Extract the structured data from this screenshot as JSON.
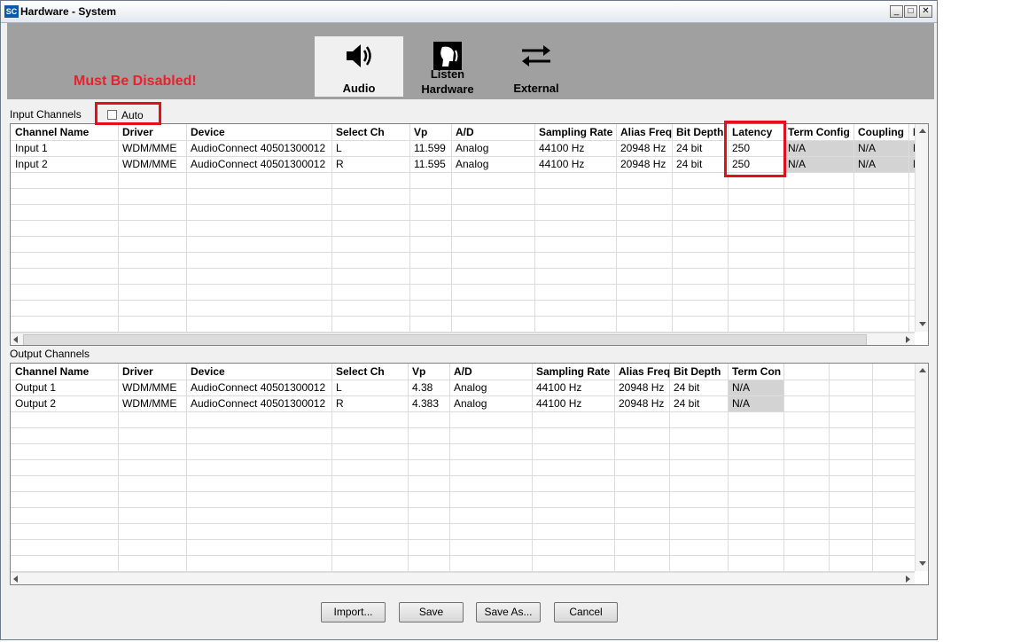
{
  "window": {
    "title": "Hardware - System",
    "icon_text": "SC",
    "controls": [
      "minimize-icon",
      "maximize-icon",
      "close-icon"
    ]
  },
  "toolbar": {
    "audio_label": "Audio",
    "listen_line1": "Listen",
    "listen_line2": "Hardware",
    "external_label": "External"
  },
  "annotation": {
    "warning": "Must Be Disabled!",
    "highlight_color": "#e3101c"
  },
  "input": {
    "section_label": "Input Channels",
    "auto_label": "Auto",
    "auto_checked": false,
    "columns": [
      "Channel Name",
      "Driver",
      "Device",
      "Select Ch",
      "Vp",
      "A/D",
      "Sampling Rate",
      "Alias Freq",
      "Bit Depth",
      "Latency",
      "Term Config",
      "Coupling",
      "I"
    ],
    "rows": [
      [
        "Input 1",
        "WDM/MME",
        "AudioConnect 40501300012",
        "L",
        "11.599",
        "Analog",
        "44100 Hz",
        "20948 Hz",
        "24 bit",
        "250",
        "N/A",
        "N/A",
        "N"
      ],
      [
        "Input 2",
        "WDM/MME",
        "AudioConnect 40501300012",
        "R",
        "11.595",
        "Analog",
        "44100 Hz",
        "20948 Hz",
        "24 bit",
        "250",
        "N/A",
        "N/A",
        "N"
      ]
    ]
  },
  "output": {
    "section_label": "Output Channels",
    "columns": [
      "Channel Name",
      "Driver",
      "Device",
      "Select Ch",
      "Vp",
      "A/D",
      "Sampling Rate",
      "Alias Freq",
      "Bit Depth",
      "Term Con"
    ],
    "rows": [
      [
        "Output 1",
        "WDM/MME",
        "AudioConnect 40501300012",
        "L",
        "4.38",
        "Analog",
        "44100 Hz",
        "20948 Hz",
        "24 bit",
        "N/A"
      ],
      [
        "Output 2",
        "WDM/MME",
        "AudioConnect 40501300012",
        "R",
        "4.383",
        "Analog",
        "44100 Hz",
        "20948 Hz",
        "24 bit",
        "N/A"
      ]
    ]
  },
  "buttons": {
    "import": "Import...",
    "save": "Save",
    "save_as": "Save As...",
    "cancel": "Cancel"
  },
  "colors": {
    "toolbar_bg": "#a0a0a0",
    "readonly_cell": "#d3d3d3",
    "warning_text": "#e8212c"
  }
}
